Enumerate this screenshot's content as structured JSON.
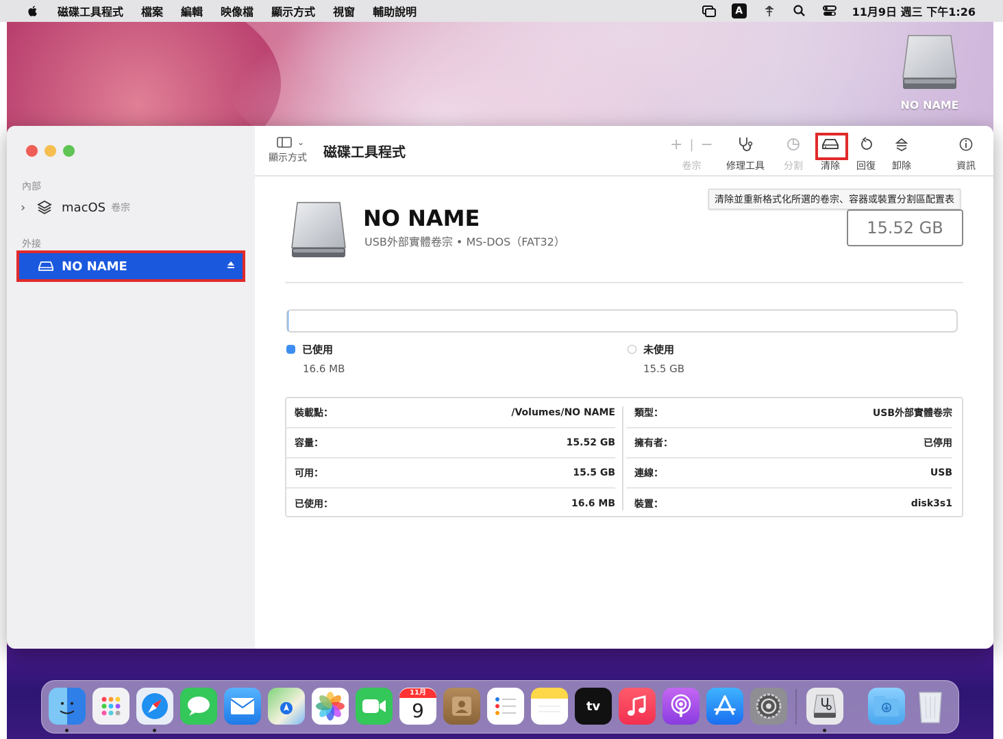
{
  "menubar": {
    "app_name": "磁碟工具程式",
    "items": [
      "檔案",
      "編輯",
      "映像檔",
      "顯示方式",
      "視窗",
      "輔助說明"
    ],
    "input_badge": "A",
    "clock": "11月9日 週三 下午1:26"
  },
  "desktop": {
    "drive_label": "NO NAME"
  },
  "sidebar": {
    "section_internal": "內部",
    "internal_item": {
      "label": "macOS",
      "sub": "卷宗"
    },
    "section_external": "外接",
    "external_item": {
      "label": "NO NAME"
    }
  },
  "toolbar": {
    "view_label": "顯示方式",
    "title": "磁碟工具程式",
    "volume_label": "卷宗",
    "first_aid_label": "修理工具",
    "partition_label": "分割",
    "erase_label": "清除",
    "restore_label": "回復",
    "unmount_label": "卸除",
    "info_label": "資訊"
  },
  "tooltip": "清除並重新格式化所選的卷宗、容器或裝置分割區配置表",
  "volume": {
    "name": "NO NAME",
    "description": "USB外部實體卷宗 • MS-DOS（FAT32）",
    "capacity": "15.52 GB"
  },
  "usage": {
    "used_label": "已使用",
    "used_value": "16.6 MB",
    "free_label": "未使用",
    "free_value": "15.5 GB",
    "used_fraction": 0.001
  },
  "info": {
    "left": [
      {
        "key": "裝載點：",
        "value": "/Volumes/NO NAME"
      },
      {
        "key": "容量：",
        "value": "15.52 GB"
      },
      {
        "key": "可用：",
        "value": "15.5 GB"
      },
      {
        "key": "已使用：",
        "value": "16.6 MB"
      }
    ],
    "right": [
      {
        "key": "類型：",
        "value": "USB外部實體卷宗"
      },
      {
        "key": "擁有者：",
        "value": "已停用"
      },
      {
        "key": "連線：",
        "value": "USB"
      },
      {
        "key": "裝置：",
        "value": "disk3s1"
      }
    ]
  },
  "dock": {
    "calendar_month": "11月",
    "calendar_day": "9",
    "tv_label": "tv"
  },
  "colors": {
    "selection_blue": "#1a58de",
    "highlight_red": "#e02a2a",
    "used_dot": "#3d8ef0"
  }
}
